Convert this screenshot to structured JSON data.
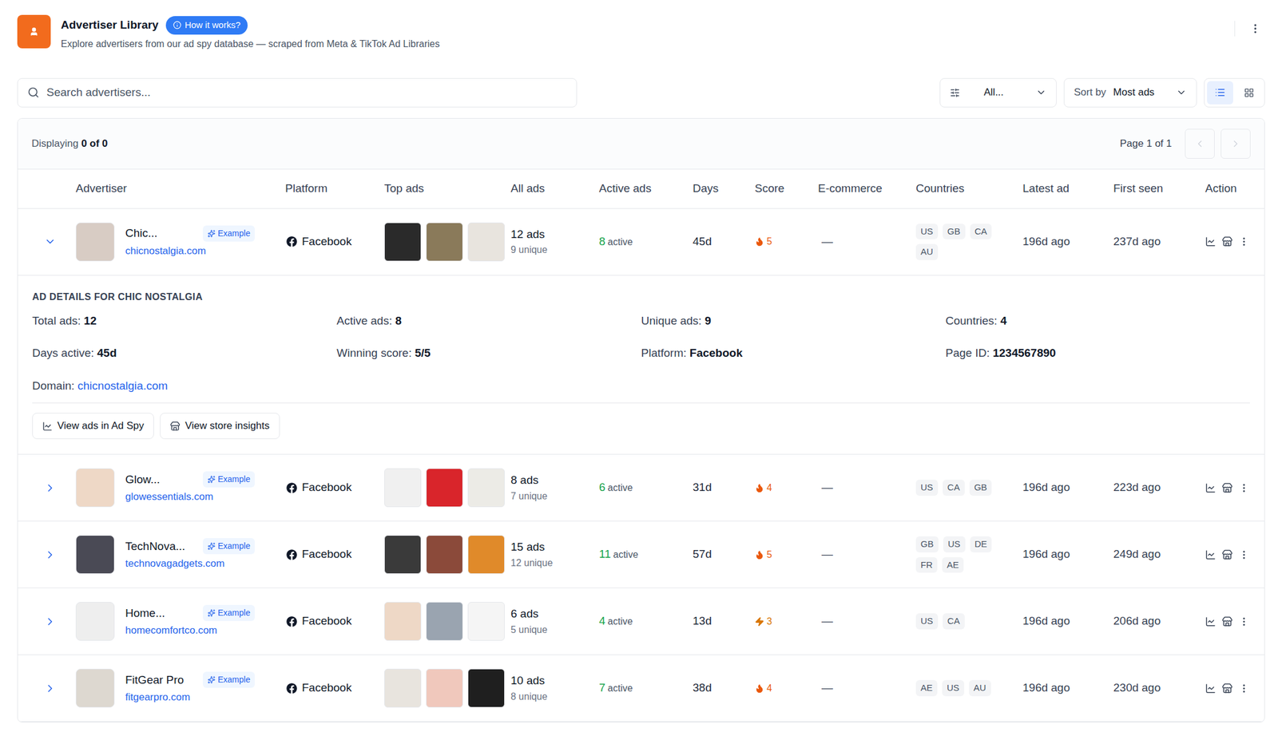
{
  "header": {
    "title": "Advertiser Library",
    "help_button": "How it works?",
    "subtitle": "Explore advertisers from our ad spy database — scraped from Meta & TikTok Ad Libraries"
  },
  "toolbar": {
    "search": {
      "placeholder": "Search advertisers..."
    },
    "filter": {
      "value": "All..."
    },
    "sort": {
      "label": "Sort by",
      "value": "Most ads"
    },
    "view_modes": [
      {
        "kind": "list",
        "selected": true
      },
      {
        "kind": "grid",
        "selected": false
      }
    ]
  },
  "table": {
    "summary": {
      "label": "Displaying",
      "count": "0 of 0"
    },
    "pagination": {
      "label": "Page 1 of 1",
      "prev_disabled": true,
      "next_disabled": true
    },
    "columns": [
      "Advertiser",
      "Platform",
      "Top ads",
      "All ads",
      "Active ads",
      "Days",
      "Score",
      "E-commerce",
      "Countries",
      "Latest ad",
      "First seen",
      "Action"
    ],
    "rows": [
      {
        "name": "Chic...",
        "badge": "Example",
        "domain": "chicnostalgia.com",
        "platform": "Facebook",
        "avatar_color": "#d8ccc4",
        "thumbs": [
          {
            "color": "#2a2a2a"
          },
          {
            "color": "#8a7a5a"
          },
          {
            "color": "#e8e4de"
          }
        ],
        "all_ads": "12 ads",
        "unique": "9 unique",
        "active_count": "8",
        "active_label": "active",
        "days": "45d",
        "score": {
          "value": "5",
          "kind": "flame",
          "color": "#ea580c"
        },
        "ecommerce": "—",
        "countries": [
          "US",
          "GB",
          "CA",
          "AU"
        ],
        "latest": "196d ago",
        "first_seen": "237d ago",
        "expanded": true,
        "details": {
          "title": "AD DETAILS FOR CHIC NOSTALGIA",
          "fields": [
            {
              "label": "Total ads:",
              "value": "12",
              "kind": "text"
            },
            {
              "label": "Active ads:",
              "value": "8",
              "kind": "text"
            },
            {
              "label": "Unique ads:",
              "value": "9",
              "kind": "text"
            },
            {
              "label": "Countries:",
              "value": "4",
              "kind": "text"
            },
            {
              "label": "Days active:",
              "value": "45d",
              "kind": "text"
            },
            {
              "label": "Winning score:",
              "value": "5/5",
              "kind": "text"
            },
            {
              "label": "Platform:",
              "value": "Facebook",
              "kind": "text"
            },
            {
              "label": "Page ID:",
              "value": "1234567890",
              "kind": "text"
            },
            {
              "label": "Domain:",
              "value": "chicnostalgia.com",
              "kind": "link"
            }
          ],
          "buttons": [
            {
              "label": "View ads in Ad Spy",
              "kind": "chart"
            },
            {
              "label": "View store insights",
              "kind": "store"
            }
          ]
        }
      },
      {
        "name": "Glow...",
        "badge": "Example",
        "domain": "glowessentials.com",
        "platform": "Facebook",
        "avatar_color": "#eed8c6",
        "thumbs": [
          {
            "color": "#f0f0f0"
          },
          {
            "color": "#d9252b"
          },
          {
            "color": "#ecebe6"
          }
        ],
        "all_ads": "8 ads",
        "unique": "7 unique",
        "active_count": "6",
        "active_label": "active",
        "days": "31d",
        "score": {
          "value": "4",
          "kind": "flame",
          "color": "#ea580c"
        },
        "ecommerce": "—",
        "countries": [
          "US",
          "CA",
          "GB"
        ],
        "latest": "196d ago",
        "first_seen": "223d ago",
        "expanded": false
      },
      {
        "name": "TechNova...",
        "badge": "Example",
        "domain": "technovagadgets.com",
        "platform": "Facebook",
        "avatar_color": "#4a4a55",
        "thumbs": [
          {
            "color": "#3a3a3a"
          },
          {
            "color": "#8b4a3a"
          },
          {
            "color": "#e08a2a"
          }
        ],
        "all_ads": "15 ads",
        "unique": "12 unique",
        "active_count": "11",
        "active_label": "active",
        "days": "57d",
        "score": {
          "value": "5",
          "kind": "flame",
          "color": "#ea580c"
        },
        "ecommerce": "—",
        "countries": [
          "GB",
          "US",
          "DE",
          "FR",
          "AE"
        ],
        "latest": "196d ago",
        "first_seen": "249d ago",
        "expanded": false
      },
      {
        "name": "Home...",
        "badge": "Example",
        "domain": "homecomfortco.com",
        "platform": "Facebook",
        "avatar_color": "#eeeeee",
        "thumbs": [
          {
            "color": "#eed8c6"
          },
          {
            "color": "#9aa4b0"
          },
          {
            "color": "#f5f5f5"
          }
        ],
        "all_ads": "6 ads",
        "unique": "5 unique",
        "active_count": "4",
        "active_label": "active",
        "days": "13d",
        "score": {
          "value": "3",
          "kind": "bolt",
          "color": "#d97706"
        },
        "ecommerce": "—",
        "countries": [
          "US",
          "CA"
        ],
        "latest": "196d ago",
        "first_seen": "206d ago",
        "expanded": false
      },
      {
        "name": "FitGear Pro",
        "badge": "Example",
        "domain": "fitgearpro.com",
        "platform": "Facebook",
        "avatar_color": "#ddd8d0",
        "thumbs": [
          {
            "color": "#e8e4de"
          },
          {
            "color": "#f0c8bc"
          },
          {
            "color": "#1f1f1f"
          }
        ],
        "all_ads": "10 ads",
        "unique": "8 unique",
        "active_count": "7",
        "active_label": "active",
        "days": "38d",
        "score": {
          "value": "4",
          "kind": "flame",
          "color": "#ea580c"
        },
        "ecommerce": "—",
        "countries": [
          "AE",
          "US",
          "AU"
        ],
        "latest": "196d ago",
        "first_seen": "230d ago",
        "expanded": false
      }
    ]
  }
}
